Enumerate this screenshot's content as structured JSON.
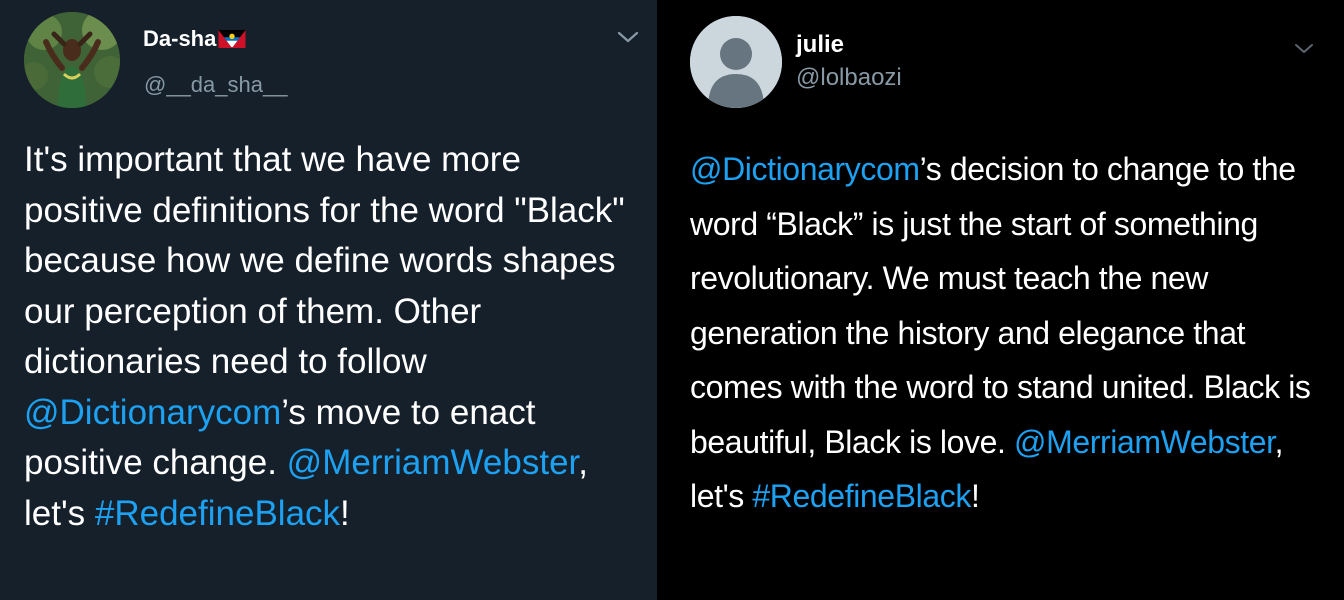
{
  "left_tweet": {
    "name": "Da-sha",
    "flag_icon": "antigua-and-barbuda-flag",
    "handle": "@__da_sha__",
    "text_1": "It's important that we have more positive definitions for the word \"Black\" because how we define words shapes our perception of them. Other dictionaries need to follow ",
    "mention_1": "@Dictionarycom",
    "text_2": "’s move to enact positive change. ",
    "mention_2": "@MerriamWebster",
    "text_3": ", let's ",
    "hashtag": "#RedefineBlack",
    "text_4": "!",
    "menu_icon": "chevron-down-icon",
    "colors": {
      "background": "#15202b",
      "text": "#ffffff",
      "secondary": "#8899a6",
      "link": "#1da1f2"
    }
  },
  "right_tweet": {
    "name": "julie",
    "handle": "@lolbaozi",
    "mention_1": "@Dictionarycom",
    "text_1": "’s decision to change to the word “Black” is just the start of something revolutionary. We must teach the new generation the history and elegance that comes with the word to stand united. Black is beautiful, Black is love. ",
    "mention_2": "@MerriamWebster",
    "text_2": ", let's ",
    "hashtag": "#RedefineBlack",
    "text_3": "!",
    "menu_icon": "chevron-down-icon",
    "colors": {
      "background": "#000000",
      "text": "#ffffff",
      "secondary": "#8899a6",
      "link": "#1da1f2"
    }
  }
}
